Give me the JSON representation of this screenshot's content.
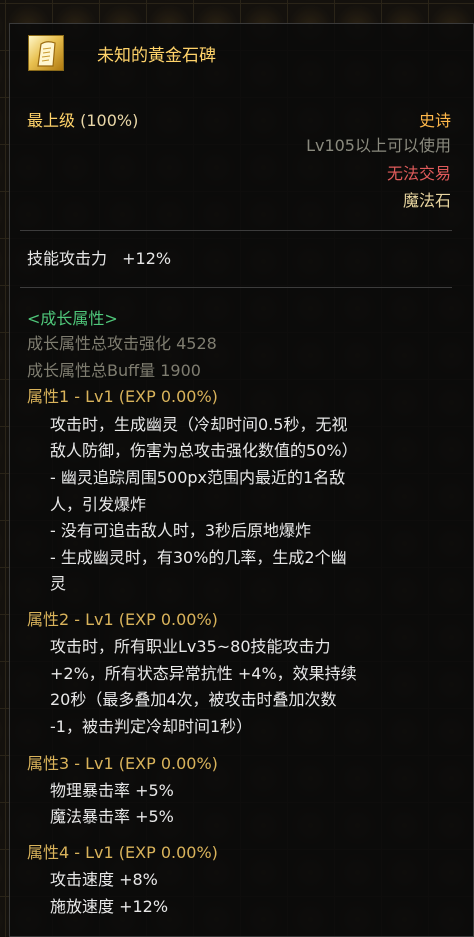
{
  "item": {
    "name": "未知的黃金石碑",
    "grade": "最上级",
    "grade_pct": "(100%)",
    "rarity": "史诗",
    "level_req": "Lv105以上可以使用",
    "trade": "无法交易",
    "type": "魔法石"
  },
  "stats": {
    "skill_atk": "技能攻击力",
    "skill_atk_val": "+12%"
  },
  "growth": {
    "header": "<成长属性>",
    "total_atk": "成长属性总攻击强化 4528",
    "total_buff": "成长属性总Buff量 1900"
  },
  "attributes": [
    {
      "title": "属性1 - Lv1 (EXP 0.00%)",
      "lines": [
        "攻击时，生成幽灵（冷却时间0.5秒，无视",
        "敌人防御，伤害为总攻击强化数值的50%）",
        "- 幽灵追踪周围500px范围内最近的1名敌",
        "人，引发爆炸",
        "- 没有可追击敌人时，3秒后原地爆炸",
        "- 生成幽灵时，有30%的几率，生成2个幽",
        "灵"
      ]
    },
    {
      "title": "属性2 - Lv1 (EXP 0.00%)",
      "lines": [
        "攻击时，所有职业Lv35~80技能攻击力",
        "+2%，所有状态异常抗性 +4%，效果持续",
        "20秒（最多叠加4次，被攻击时叠加次数",
        "-1，被击判定冷却时间1秒）"
      ]
    },
    {
      "title": "属性3 - Lv1 (EXP 0.00%)",
      "lines": [
        "物理暴击率 +5%",
        "魔法暴击率 +5%"
      ]
    },
    {
      "title": "属性4 - Lv1 (EXP 0.00%)",
      "lines": [
        "攻击速度 +8%",
        "施放速度 +12%"
      ]
    }
  ]
}
